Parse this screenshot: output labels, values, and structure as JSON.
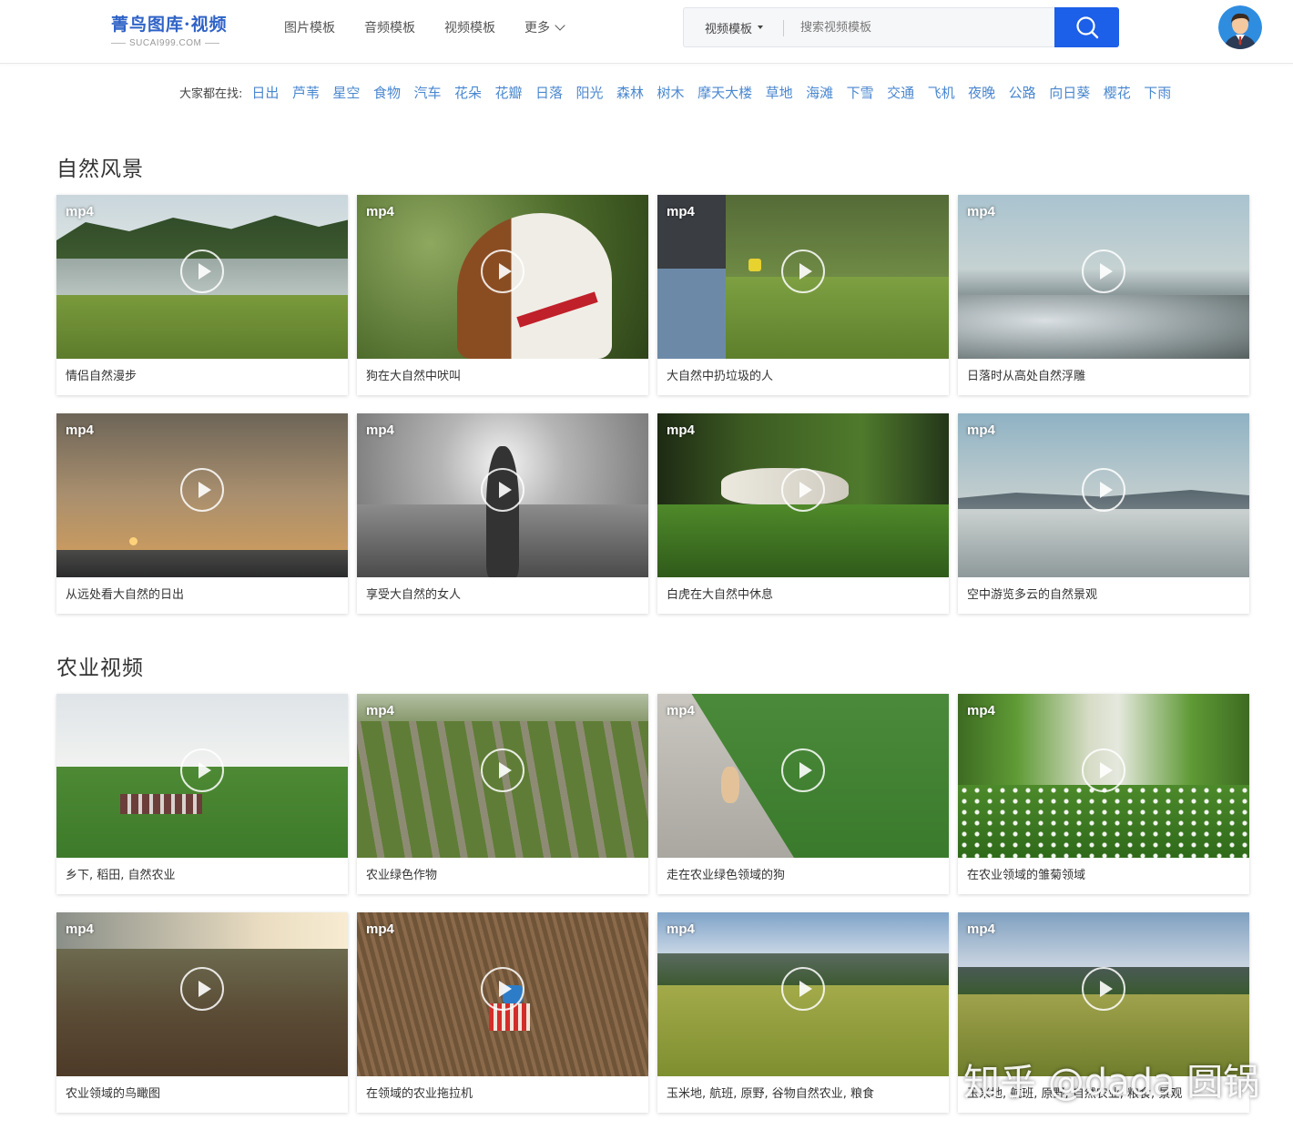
{
  "brand": {
    "name": "菁鸟图库·视频",
    "domain": "SUCAI999.COM"
  },
  "nav": {
    "items": [
      "图片模板",
      "音频模板",
      "视频模板",
      "更多"
    ]
  },
  "search": {
    "category": "视频模板",
    "placeholder": "搜索视频模板"
  },
  "hot_search": {
    "label": "大家都在找:",
    "tags": [
      "日出",
      "芦苇",
      "星空",
      "食物",
      "汽车",
      "花朵",
      "花瓣",
      "日落",
      "阳光",
      "森林",
      "树木",
      "摩天大楼",
      "草地",
      "海滩",
      "下雪",
      "交通",
      "飞机",
      "夜晚",
      "公路",
      "向日葵",
      "樱花",
      "下雨"
    ]
  },
  "sections": [
    {
      "title": "自然风景",
      "cards": [
        {
          "format": "mp4",
          "title": "情侣自然漫步"
        },
        {
          "format": "mp4",
          "title": "狗在大自然中吠叫"
        },
        {
          "format": "mp4",
          "title": "大自然中扔垃圾的人"
        },
        {
          "format": "mp4",
          "title": "日落时从高处自然浮雕"
        },
        {
          "format": "mp4",
          "title": "从远处看大自然的日出"
        },
        {
          "format": "mp4",
          "title": "享受大自然的女人"
        },
        {
          "format": "mp4",
          "title": "白虎在大自然中休息"
        },
        {
          "format": "mp4",
          "title": "空中游览多云的自然景观"
        }
      ]
    },
    {
      "title": "农业视频",
      "cards": [
        {
          "format": "",
          "title": "乡下, 稻田, 自然农业"
        },
        {
          "format": "mp4",
          "title": "农业绿色作物"
        },
        {
          "format": "mp4",
          "title": "走在农业绿色领域的狗"
        },
        {
          "format": "mp4",
          "title": "在农业领域的雏菊领域"
        },
        {
          "format": "mp4",
          "title": "农业领域的鸟瞰图"
        },
        {
          "format": "mp4",
          "title": "在领域的农业拖拉机"
        },
        {
          "format": "mp4",
          "title": "玉米地, 航班, 原野, 谷物自然农业, 粮食"
        },
        {
          "format": "mp4",
          "title": "玉米地, 航班, 原野, 自然农业, 粮食, 景观"
        }
      ]
    }
  ],
  "watermark": "知乎 @dada 圆锅",
  "colors": {
    "accent": "#1c5fe8",
    "link": "#4a87cf",
    "brand": "#2f63c7"
  },
  "icons": {
    "search": "search-icon",
    "avatar": "avatar",
    "play": "play-icon",
    "more": "chevron-down-icon"
  }
}
